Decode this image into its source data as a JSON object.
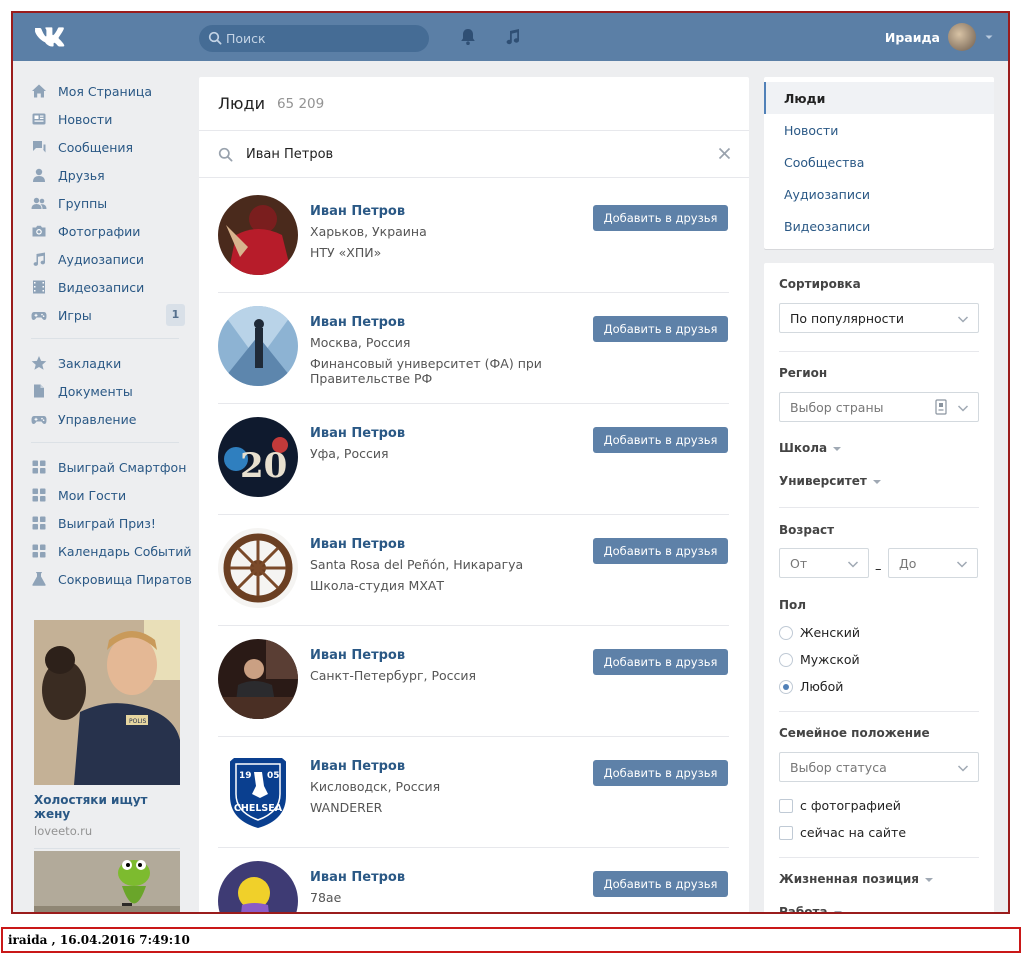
{
  "header": {
    "search_placeholder": "Поиск",
    "user_name": "Ираида"
  },
  "leftnav": {
    "items": [
      {
        "label": "Моя Страница",
        "icon": "home-icon"
      },
      {
        "label": "Новости",
        "icon": "news-icon"
      },
      {
        "label": "Сообщения",
        "icon": "messages-icon"
      },
      {
        "label": "Друзья",
        "icon": "friends-icon"
      },
      {
        "label": "Группы",
        "icon": "groups-icon"
      },
      {
        "label": "Фотографии",
        "icon": "camera-icon"
      },
      {
        "label": "Аудиозаписи",
        "icon": "music-icon"
      },
      {
        "label": "Видеозаписи",
        "icon": "film-icon"
      },
      {
        "label": "Игры",
        "icon": "gamepad-icon",
        "badge": "1"
      },
      {
        "label": "Закладки",
        "icon": "star-icon"
      },
      {
        "label": "Документы",
        "icon": "document-icon"
      },
      {
        "label": "Управление",
        "icon": "gamepad-icon"
      },
      {
        "label": "Выиграй Смартфон",
        "icon": "apps-icon"
      },
      {
        "label": "Мои Гости",
        "icon": "apps-icon"
      },
      {
        "label": "Выиграй Приз!",
        "icon": "apps-icon"
      },
      {
        "label": "Календарь Событий",
        "icon": "apps-icon"
      },
      {
        "label": "Сокровища Пиратов",
        "icon": "flask-icon"
      }
    ],
    "ad": {
      "title": "Холостяки ищут жену",
      "url": "loveeto.ru",
      "badge_text": "POLIS"
    }
  },
  "people": {
    "title": "Люди",
    "count": "65 209",
    "query": "Иван Петров",
    "add_label": "Добавить в друзья",
    "results": [
      {
        "name": "Иван Петров",
        "line1": "Харьков, Украина",
        "line2": "НТУ «ХПИ»"
      },
      {
        "name": "Иван Петров",
        "line1": "Москва, Россия",
        "line2": "Финансовый университет (ФА) при Правительстве РФ"
      },
      {
        "name": "Иван Петров",
        "line1": "Уфа, Россия",
        "line2": "",
        "avatar_text": "20"
      },
      {
        "name": "Иван Петров",
        "line1": "Santa Rosa del Peñón, Никарагуа",
        "line2": "Школа-студия МХАТ"
      },
      {
        "name": "Иван Петров",
        "line1": "Санкт-Петербург, Россия",
        "line2": ""
      },
      {
        "name": "Иван Петров",
        "line1": "Кисловодск, Россия",
        "line2": "WANDERER",
        "avatar_text": "CHELSEA",
        "avatar_year_left": "19",
        "avatar_year_right": "05"
      },
      {
        "name": "Иван Петров",
        "line1": "78ae",
        "line2": ""
      }
    ]
  },
  "tabs": [
    "Люди",
    "Новости",
    "Сообщества",
    "Аудиозаписи",
    "Видеозаписи"
  ],
  "filters": {
    "sort_label": "Сортировка",
    "sort_value": "По популярности",
    "region_label": "Регион",
    "region_placeholder": "Выбор страны",
    "school_label": "Школа",
    "university_label": "Университет",
    "age_label": "Возраст",
    "age_from": "От",
    "age_dash": "–",
    "age_to": "До",
    "sex_label": "Пол",
    "sex_options": [
      "Женский",
      "Мужской",
      "Любой"
    ],
    "sex_selected": "Любой",
    "marital_label": "Семейное положение",
    "marital_placeholder": "Выбор статуса",
    "with_photo": "с фотографией",
    "online_now": "сейчас на сайте",
    "life_position_label": "Жизненная позиция",
    "work_label": "Работа"
  },
  "stamp": "iraida  ,  16.04.2016 7:49:10",
  "colors": {
    "header_bg": "#5b7fa6",
    "link": "#2a5885",
    "button_bg": "#5e81a8",
    "page_bg": "#edeef0"
  }
}
